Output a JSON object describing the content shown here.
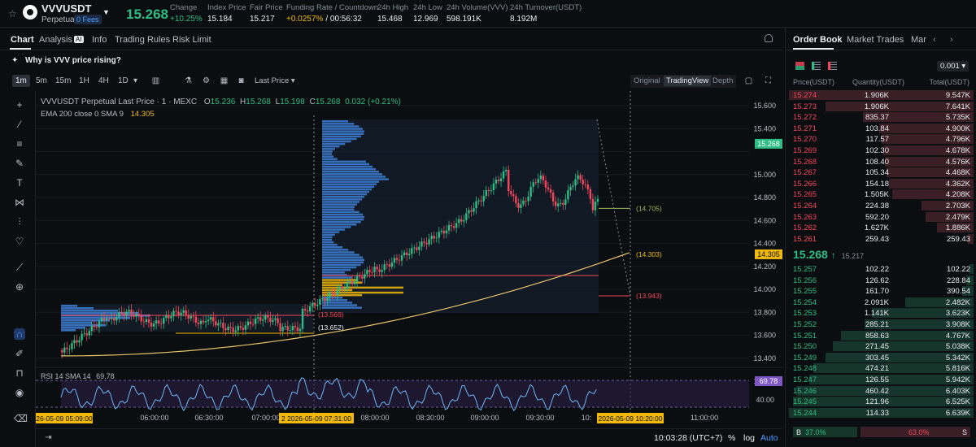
{
  "ticker": {
    "symbol": "VVVUSDT",
    "contract": "Perpetual",
    "fees_badge": "0 Fees",
    "last_price": "15.268",
    "stats": [
      {
        "label": "Change",
        "value": "+10.25%",
        "color": "#2ebd85"
      },
      {
        "label": "Index Price",
        "value": "15.184"
      },
      {
        "label": "Fair Price",
        "value": "15.217"
      },
      {
        "label": "Funding Rate / Countdown",
        "value": "+0.0257%",
        "value2": "/ 00:56:32"
      },
      {
        "label": "24h High",
        "value": "15.468"
      },
      {
        "label": "24h Low",
        "value": "12.969"
      },
      {
        "label": "24h Volume(VVV)",
        "value": "598.191K"
      },
      {
        "label": "24h Turnover(USDT)",
        "value": "8.192M"
      }
    ]
  },
  "panel_tabs": {
    "chart": "Chart",
    "analysis": "Analysis",
    "ai_badge": "AI",
    "info": "Info",
    "rules": "Trading Rules",
    "risk": "Risk Limit"
  },
  "why_text": "Why is VVV price rising?",
  "toolbar": {
    "timeframes": [
      "1m",
      "5m",
      "15m",
      "1H",
      "4H",
      "1D"
    ],
    "price_type": "Last Price",
    "views": [
      "Original",
      "TradingView",
      "Depth"
    ],
    "active_view": "TradingView"
  },
  "chart_data": {
    "type": "candlestick",
    "title": "VVVUSDT Perpetual Last Price · 1 · MEXC",
    "ohlc": {
      "o": "15.236",
      "h": "15.268",
      "l": "15.198",
      "c": "15.268",
      "chg": "0.032 (+0.21%)"
    },
    "ema_label": "EMA 200 close 0 SMA 9",
    "ema_value": "14.305",
    "rsi_label": "RSI 14 SMA 14",
    "rsi_value": "69.78",
    "y_ticks": [
      "15.600",
      "15.400",
      "15.200",
      "15.000",
      "14.800",
      "14.600",
      "14.400",
      "14.200",
      "14.000",
      "13.800",
      "13.600",
      "13.400",
      "13.200"
    ],
    "rsi_ticks": [
      "60.00",
      "40.00"
    ],
    "x_ticks": [
      "06:00:00",
      "06:30:00",
      "07:00:00",
      "08:00:00",
      "08:30:00",
      "09:00:00",
      "09:30:00",
      "11:00:00"
    ],
    "x_cursor_labels": [
      "26-05-09  05:09:00",
      "2  2026-05-09  07:31:00",
      "2026-05-09  10:20:00"
    ],
    "x_partial_tick": "10:",
    "price_label": "15.268",
    "level_labels": [
      {
        "text": "(14.705)",
        "value": 14.705,
        "color": "#9ab75a"
      },
      {
        "text": "(14.303)",
        "value": 14.303,
        "color": "#f0b90b"
      },
      {
        "text": "(13.943)",
        "value": 13.943,
        "color": "#f6465d"
      },
      {
        "text": "(13.652)",
        "value": 13.652,
        "color": "#eaecef"
      },
      {
        "text": "(13.569)",
        "value": 13.569,
        "color": "#f6465d"
      }
    ]
  },
  "status": {
    "clock": "10:03:28 (UTC+7)",
    "pct": "%",
    "log": "log",
    "auto": "Auto"
  },
  "orderbook": {
    "tabs": [
      "Order Book",
      "Market Trades",
      "Mar"
    ],
    "tick_size": "0.001",
    "headers": [
      "Price(USDT)",
      "Quantity(USDT)",
      "Total(USDT)"
    ],
    "asks": [
      {
        "price": "15.274",
        "qty": "1.906K",
        "total": "9.547K",
        "depth": 1.0
      },
      {
        "price": "15.273",
        "qty": "1.906K",
        "total": "7.641K",
        "depth": 0.8
      },
      {
        "price": "15.272",
        "qty": "835.37",
        "total": "5.735K",
        "depth": 0.6
      },
      {
        "price": "15.271",
        "qty": "103.84",
        "total": "4.900K",
        "depth": 0.51
      },
      {
        "price": "15.270",
        "qty": "117.57",
        "total": "4.796K",
        "depth": 0.5
      },
      {
        "price": "15.269",
        "qty": "102.30",
        "total": "4.678K",
        "depth": 0.49
      },
      {
        "price": "15.268",
        "qty": "108.40",
        "total": "4.576K",
        "depth": 0.48
      },
      {
        "price": "15.267",
        "qty": "105.34",
        "total": "4.468K",
        "depth": 0.47
      },
      {
        "price": "15.266",
        "qty": "154.18",
        "total": "4.362K",
        "depth": 0.46
      },
      {
        "price": "15.265",
        "qty": "1.505K",
        "total": "4.208K",
        "depth": 0.44
      },
      {
        "price": "15.264",
        "qty": "224.38",
        "total": "2.703K",
        "depth": 0.28
      },
      {
        "price": "15.263",
        "qty": "592.20",
        "total": "2.479K",
        "depth": 0.26
      },
      {
        "price": "15.262",
        "qty": "1.627K",
        "total": "1.886K",
        "depth": 0.2
      },
      {
        "price": "15.261",
        "qty": "259.43",
        "total": "259.43",
        "depth": 0.03
      }
    ],
    "mid_price": "15.268",
    "mid_arrow": "↑",
    "mid_fair": "15.217",
    "bids": [
      {
        "price": "15.257",
        "qty": "102.22",
        "total": "102.22",
        "depth": 0.02
      },
      {
        "price": "15.256",
        "qty": "126.62",
        "total": "228.84",
        "depth": 0.04
      },
      {
        "price": "15.255",
        "qty": "161.70",
        "total": "390.54",
        "depth": 0.06
      },
      {
        "price": "15.254",
        "qty": "2.091K",
        "total": "2.482K",
        "depth": 0.37
      },
      {
        "price": "15.253",
        "qty": "1.141K",
        "total": "3.623K",
        "depth": 0.55
      },
      {
        "price": "15.252",
        "qty": "285.21",
        "total": "3.908K",
        "depth": 0.59
      },
      {
        "price": "15.251",
        "qty": "858.63",
        "total": "4.767K",
        "depth": 0.72
      },
      {
        "price": "15.250",
        "qty": "271.45",
        "total": "5.038K",
        "depth": 0.76
      },
      {
        "price": "15.249",
        "qty": "303.45",
        "total": "5.342K",
        "depth": 0.8
      },
      {
        "price": "15.248",
        "qty": "474.21",
        "total": "5.816K",
        "depth": 0.87
      },
      {
        "price": "15.247",
        "qty": "126.55",
        "total": "5.942K",
        "depth": 0.89
      },
      {
        "price": "15.246",
        "qty": "460.42",
        "total": "6.403K",
        "depth": 0.96
      },
      {
        "price": "15.245",
        "qty": "121.96",
        "total": "6.525K",
        "depth": 0.98
      },
      {
        "price": "15.244",
        "qty": "114.33",
        "total": "6.639K",
        "depth": 1.0
      }
    ],
    "ratio": {
      "buy_label": "B",
      "buy_pct": "37.0%",
      "sell_pct": "63.0%",
      "sell_label": "S"
    }
  }
}
